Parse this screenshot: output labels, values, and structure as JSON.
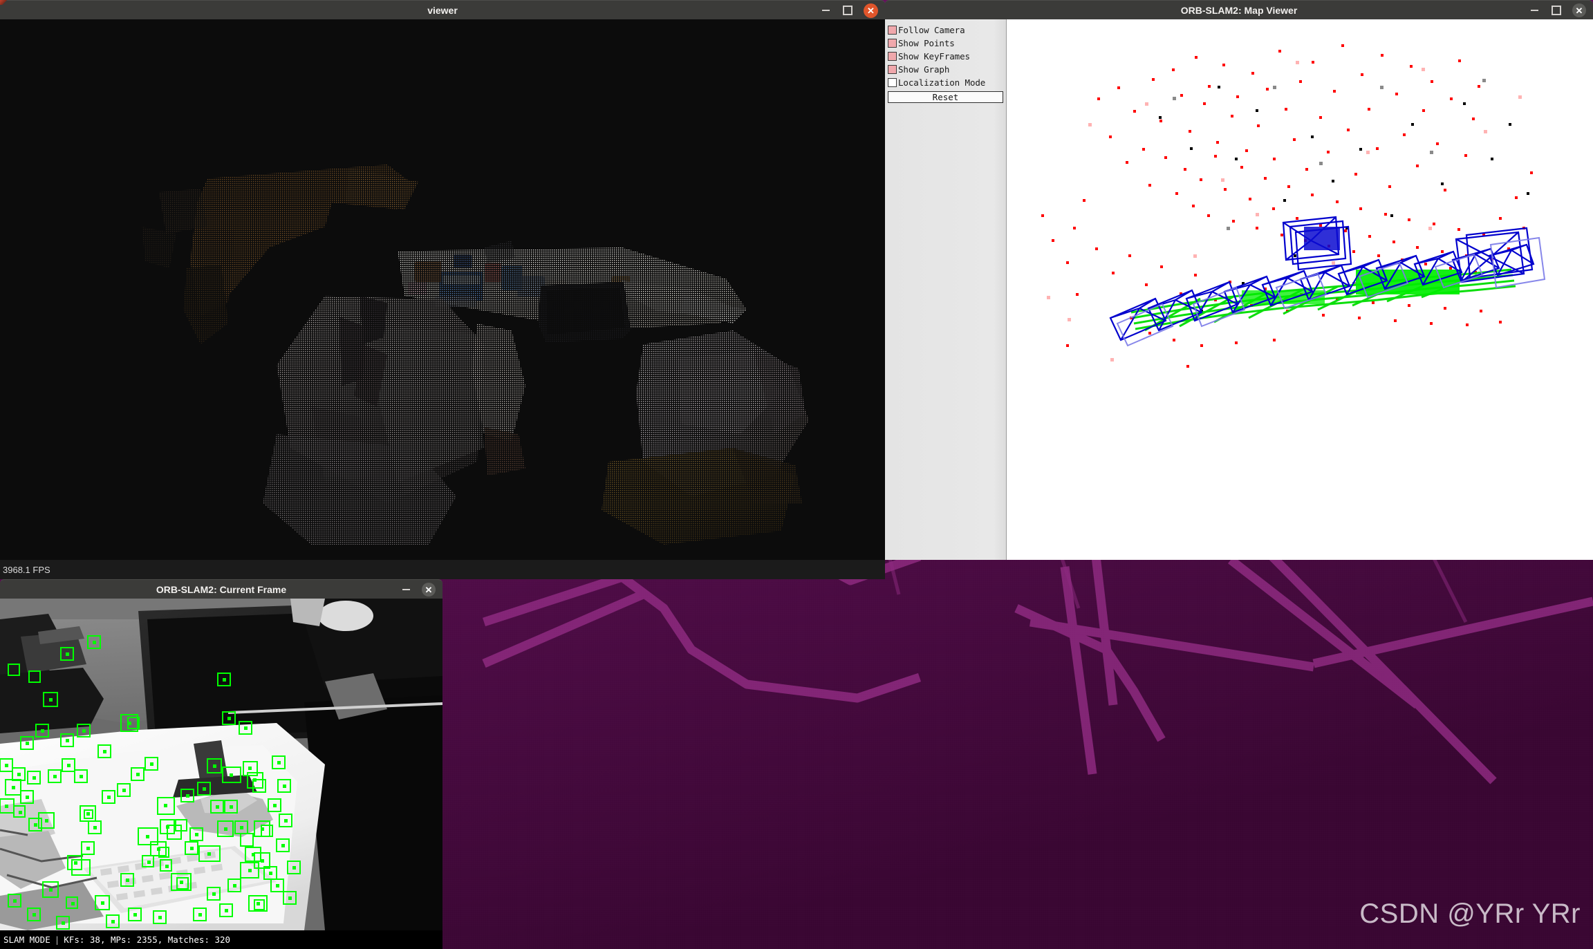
{
  "desktop": {
    "wallpaper_base_color": "#5c1055",
    "wallpaper_line_color": "#8e2a80",
    "watermark": "CSDN @YRr YRr"
  },
  "windows": {
    "viewer": {
      "title": "viewer",
      "controls": {
        "minimize": "–",
        "maximize": "☐",
        "close": "✕"
      },
      "close_color": "#e0552b",
      "status_text": "3968.1 FPS",
      "canvas_background": "#0c0c0c",
      "content_description": "dense-colored-point-cloud-office-desk-scene"
    },
    "map_viewer": {
      "title": "ORB-SLAM2: Map Viewer",
      "controls": {
        "minimize": "–",
        "maximize": "☐",
        "close": "✕"
      },
      "close_color": "#5c5c59",
      "panel": {
        "checkboxes": [
          {
            "label": "Follow Camera",
            "checked": true
          },
          {
            "label": "Show Points",
            "checked": true
          },
          {
            "label": "Show KeyFrames",
            "checked": true
          },
          {
            "label": "Show Graph",
            "checked": true
          },
          {
            "label": "Localization Mode",
            "checked": false
          }
        ],
        "reset_label": "Reset",
        "checked_color": "#f0a8ac",
        "panel_background": "#e5e5e5"
      },
      "canvas": {
        "background": "#ffffff",
        "map_point_color": "#ff0000",
        "reference_point_color": "#000000",
        "keyframe_color": "#0000ff",
        "graph_color": "#00dd00"
      }
    },
    "current_frame": {
      "title": "ORB-SLAM2: Current Frame",
      "controls": {
        "minimize": "–",
        "close": "✕"
      },
      "close_color": "#5c5c59",
      "feature_color": "#00ff00",
      "status": {
        "mode": "SLAM MODE",
        "separator": "|",
        "stats": "KFs: 38, MPs: 2355, Matches: 320"
      }
    }
  },
  "stats": {
    "fps": "3968.1 FPS",
    "keyframes": 38,
    "map_points": 2355,
    "matches": 320,
    "mode": "SLAM MODE"
  }
}
